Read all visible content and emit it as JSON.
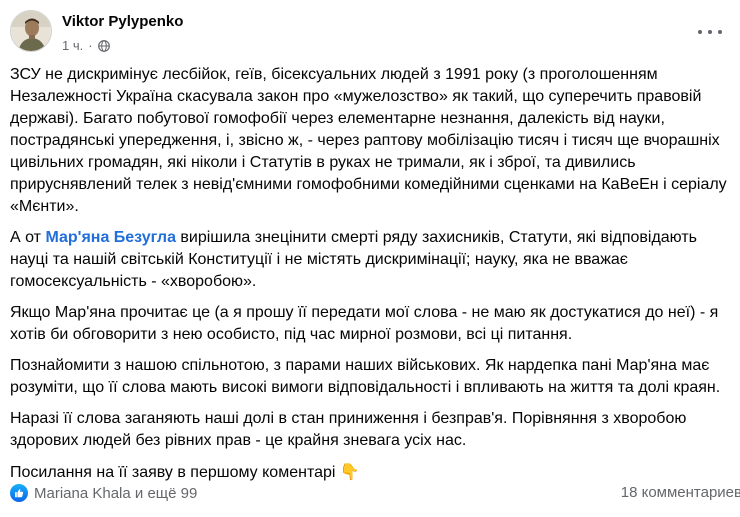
{
  "post": {
    "author": "Viktor Pylypenko",
    "time": "1 ч.",
    "separator": "·",
    "visibility_icon": "globe-icon",
    "menu_icon": "more-horizontal-icon",
    "paragraphs": [
      "ЗСУ не дискримінує лесбійок, геїв, бісексуальних людей з 1991 року (з проголошенням Незалежності Україна скасувала закон про «мужелозство» як такий, що суперечить правовій державі). Багато побутової гомофобії через елементарне незнання, далекість від науки, пострадянські упередження, і, звісно ж, - через раптову мобілізацію тисяч і тисяч ще вчорашніх цивільних громадян, які ніколи і Статутів в руках не тримали, як і зброї, та дивились прируснявлений телек з невід'ємними гомофобними комедійними сценками на КаВеЕн і серіалу «Мєнти»."
    ],
    "p2_before": "А от ",
    "p2_mention": "Мар'яна Безугла",
    "p2_after": " вирішила знецінити смерті ряду захисників, Статути, які відповідають науці та нашій світській Конституції і не містять дискримінації; науку, яка не вважає гомосексуальність - «хворобою».",
    "paragraphs_rest": [
      "Якщо Мар'яна прочитає це (а я прошу її передати мої слова - не маю як достукатися до неї) - я хотів би обговорити з нею особисто, під час мирної розмови, всі ці питання.",
      "Познайомити з нашою спільнотою, з парами наших військових. Як нардепка пані Мар'яна має розуміти, що її слова мають високі вимоги відповідальності і впливають на життя та долі краян.",
      "Наразі її слова заганяють наші долі в стан приниження і безправ'я. Порівняння з хворобою здорових людей без рівних прав - це крайня зневага усіх нас."
    ],
    "last_text": "Посилання на її заяву в першому коментарі ",
    "last_emoji": "👇",
    "reactions_text": "Mariana Khala и ещё 99",
    "reaction_icon": "thumbs-up-icon",
    "comments_text": "18 комментариев"
  },
  "colors": {
    "link": "#216fdb",
    "meta": "#65676b",
    "text": "#050505",
    "like_badge": "#0b66e8"
  }
}
